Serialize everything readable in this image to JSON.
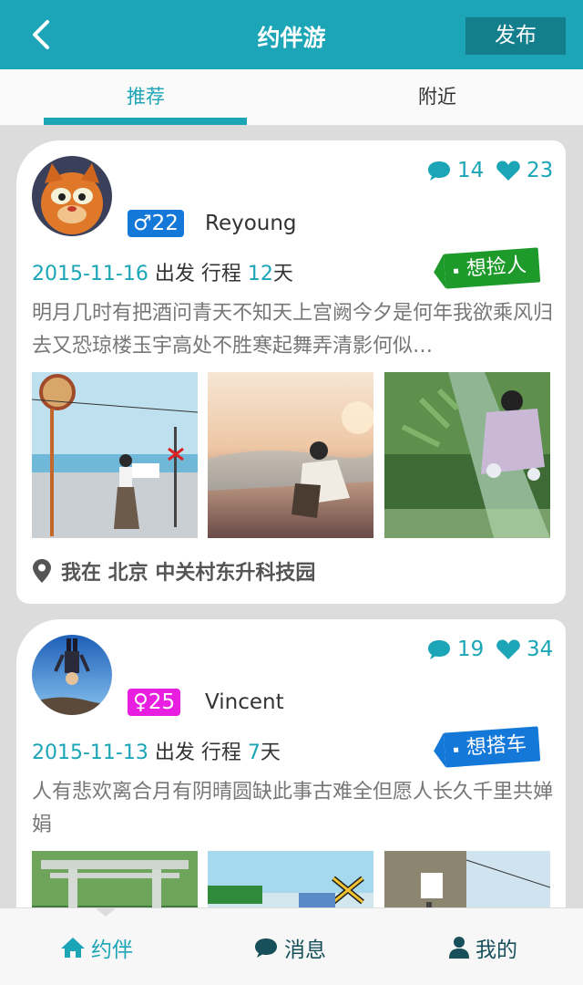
{
  "header": {
    "title": "约伴游",
    "publish_label": "发布"
  },
  "tabs": [
    {
      "label": "推荐",
      "active": true
    },
    {
      "label": "附近",
      "active": false
    }
  ],
  "posts": [
    {
      "comments": "14",
      "likes": "23",
      "gender_symbol": "♂",
      "age": "22",
      "username": "Reyoung",
      "date": "2015-11-16",
      "depart_text": "出发 行程",
      "days": "12",
      "days_unit": "天",
      "tag": "想捡人",
      "description": "明月几时有把酒问青天不知天上宫阙今夕是何年我欲乘风归去又恐琼楼玉宇高处不胜寒起舞弄清影何似…",
      "location": "我在 北京 中关村东升科技园"
    },
    {
      "comments": "19",
      "likes": "34",
      "gender_symbol": "♀",
      "age": "25",
      "username": "Vincent",
      "date": "2015-11-13",
      "depart_text": "出发 行程",
      "days": "7",
      "days_unit": "天",
      "tag": "想搭车",
      "description": "人有悲欢离合月有阴晴圆缺此事古难全但愿人长久千里共婵娟"
    }
  ],
  "bottom_nav": [
    {
      "label": "约伴",
      "icon": "home-icon",
      "active": true
    },
    {
      "label": "消息",
      "icon": "chat-icon",
      "active": false
    },
    {
      "label": "我的",
      "icon": "user-icon",
      "active": false
    }
  ],
  "colors": {
    "primary": "#1ba5b6",
    "male": "#1478d8",
    "female": "#e81fe0",
    "tag_green": "#1e9a2a",
    "tag_blue": "#1478d8",
    "nav_dark": "#17505a"
  }
}
